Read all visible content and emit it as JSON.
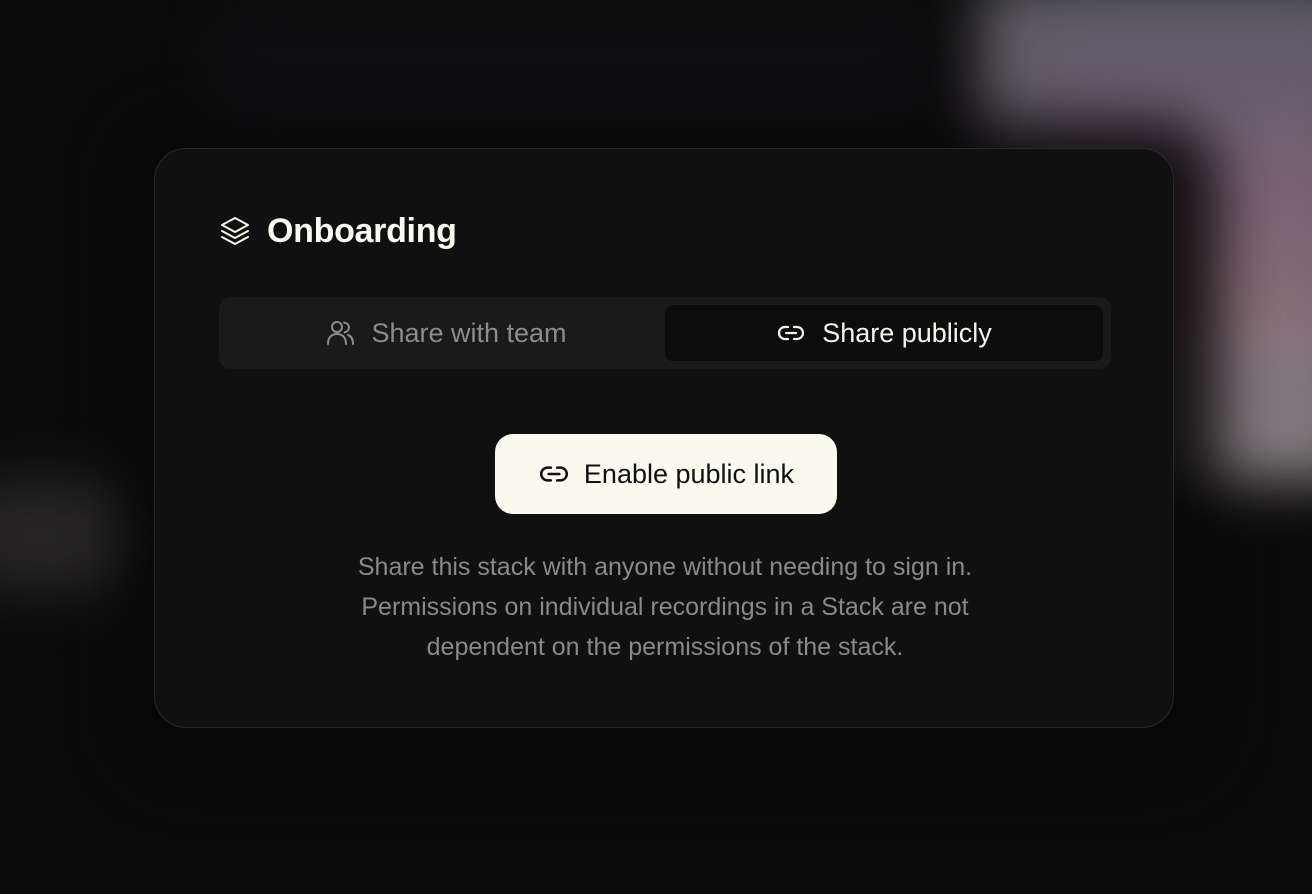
{
  "dialog": {
    "title": "Onboarding",
    "title_icon": "stack-icon"
  },
  "tabs": [
    {
      "label": "Share with team",
      "icon": "users-icon",
      "active": false
    },
    {
      "label": "Share publicly",
      "icon": "link-icon",
      "active": true
    }
  ],
  "enable_button": {
    "label": "Enable public link",
    "icon": "link-icon"
  },
  "description": {
    "line1": "Share this stack with anyone without needing to sign in.",
    "line2": "Permissions on individual recordings in a Stack are not",
    "line3": "dependent on the permissions of the stack."
  },
  "colors": {
    "background": "#0c0b0c",
    "card": "#111011",
    "button": "#fafaee",
    "text_primary": "#fbfaee",
    "text_muted": "#8a8986"
  }
}
